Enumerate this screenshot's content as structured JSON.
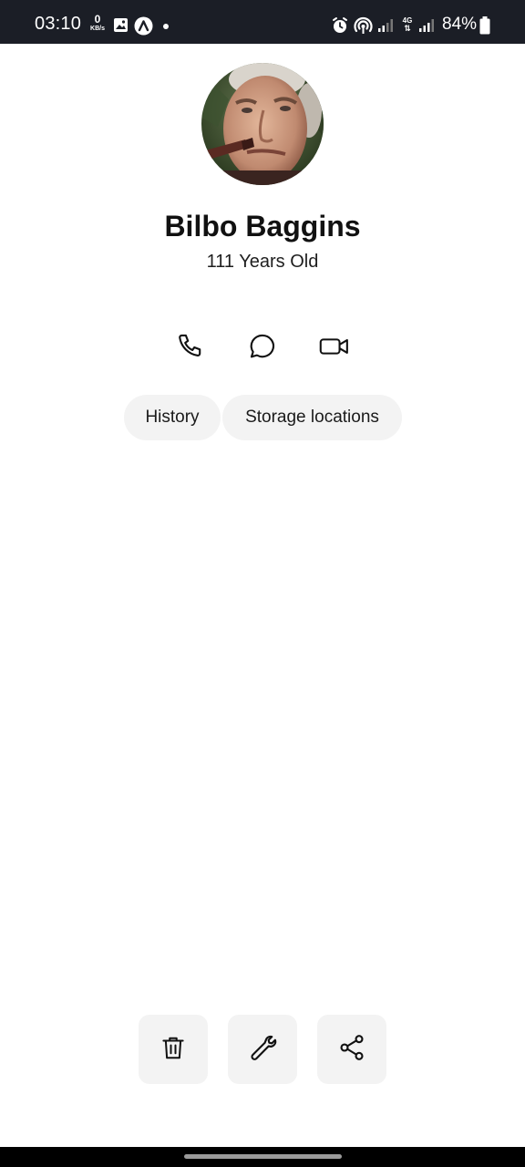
{
  "status_bar": {
    "time": "03:10",
    "net_speed_value": "0",
    "net_speed_unit": "KB/s",
    "icons": [
      "gallery-icon",
      "app-a-icon",
      "notification-dot",
      "alarm-icon",
      "hotspot-icon",
      "signal-icon",
      "4g-icon",
      "signal-icon",
      "battery-icon"
    ],
    "network_type": "4G",
    "battery_percent": "84%"
  },
  "profile": {
    "name": "Bilbo Baggins",
    "age_text": "111 Years Old"
  },
  "actions": {
    "icons": [
      "phone-icon",
      "chat-bubble-icon",
      "video-camera-icon"
    ]
  },
  "tabs": [
    {
      "label": "History"
    },
    {
      "label": "Storage locations"
    }
  ],
  "bottom_actions": {
    "icons": [
      "trash-icon",
      "wrench-icon",
      "share-icon"
    ],
    "background": "#f3f3f3"
  },
  "colors": {
    "status_bar_bg": "#1b1e26",
    "pill_bg": "#f3f3f3",
    "text": "#111111"
  }
}
